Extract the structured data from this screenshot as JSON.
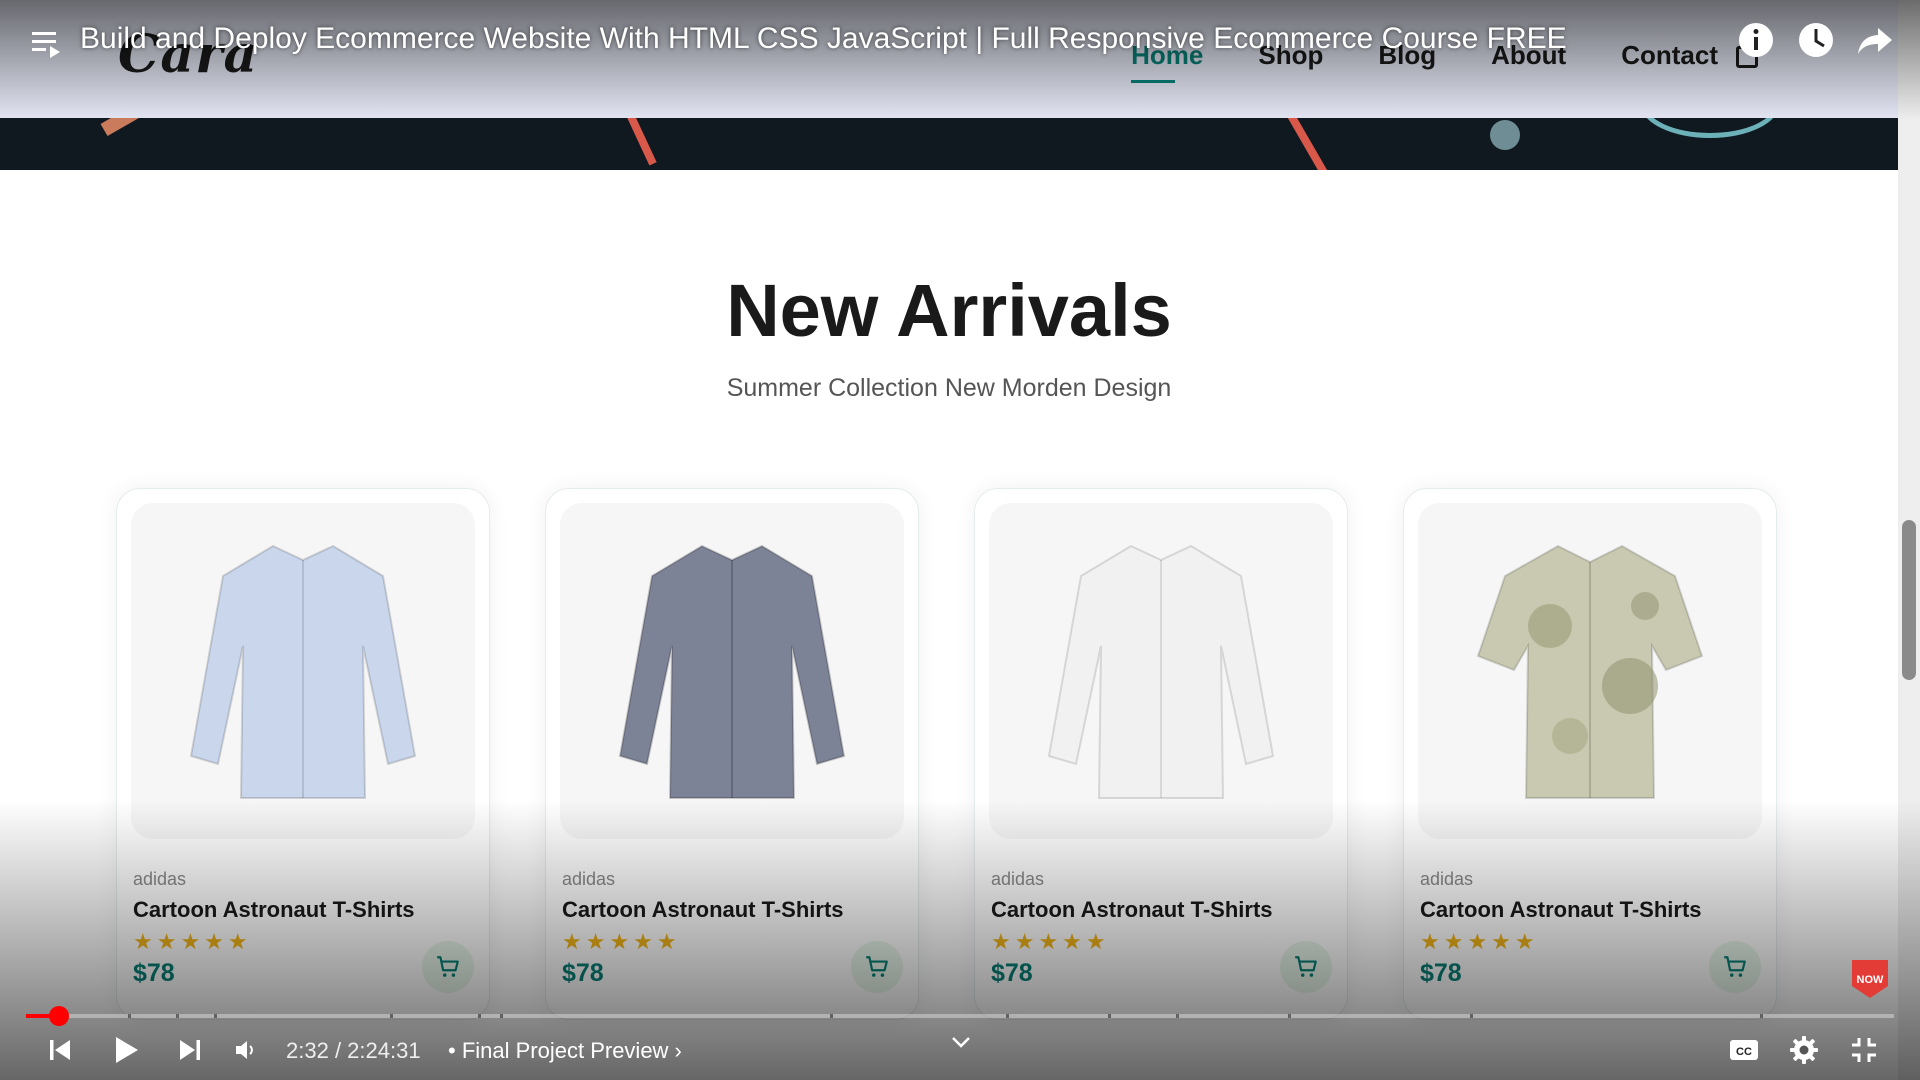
{
  "player": {
    "video_title": "Build and Deploy Ecommerce Website With HTML CSS JavaScript | Full Responsive Ecommerce Course FREE",
    "time_current": "2:32",
    "time_total": "2:24:31",
    "time_separator": " / ",
    "chapter": "• Final Project Preview ›",
    "progress_fraction": 0.0175,
    "accent_color": "#ff0000",
    "badge_text": "NOW",
    "icons": [
      "playlist-icon",
      "info-icon",
      "watch-later-icon",
      "share-icon",
      "previous-icon",
      "play-icon",
      "next-icon",
      "volume-icon",
      "chevron-down-icon",
      "captions-icon",
      "settings-icon",
      "exit-fullscreen-icon"
    ]
  },
  "site": {
    "logo": "Cara",
    "nav": [
      {
        "label": "Home",
        "active": true
      },
      {
        "label": "Shop",
        "active": false
      },
      {
        "label": "Blog",
        "active": false
      },
      {
        "label": "About",
        "active": false
      },
      {
        "label": "Contact",
        "active": false
      }
    ],
    "accent_color": "#088178"
  },
  "section": {
    "title": "New Arrivals",
    "subtitle": "Summer Collection New Morden Design"
  },
  "products": [
    {
      "brand": "adidas",
      "name": "Cartoon Astronaut T-Shirts",
      "rating": 5,
      "stars": "★★★★★",
      "price": "$78",
      "shirt_color": "#c9d6ec"
    },
    {
      "brand": "adidas",
      "name": "Cartoon Astronaut T-Shirts",
      "rating": 5,
      "stars": "★★★★★",
      "price": "$78",
      "shirt_color": "#7d8396"
    },
    {
      "brand": "adidas",
      "name": "Cartoon Astronaut T-Shirts",
      "rating": 5,
      "stars": "★★★★★",
      "price": "$78",
      "shirt_color": "#f1f1f1"
    },
    {
      "brand": "adidas",
      "name": "Cartoon Astronaut T-Shirts",
      "rating": 5,
      "stars": "★★★★★",
      "price": "$78",
      "shirt_color": "#c8c9b0"
    }
  ]
}
